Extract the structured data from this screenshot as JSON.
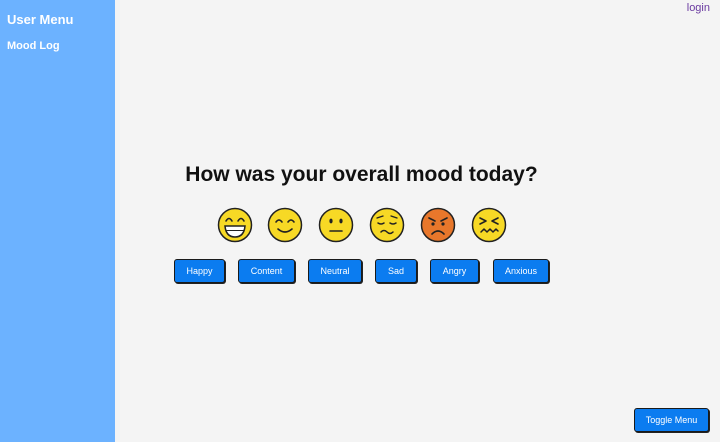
{
  "sidebar": {
    "title": "User Menu",
    "items": [
      {
        "label": "Mood Log"
      }
    ]
  },
  "header": {
    "login_label": "login"
  },
  "main": {
    "question": "How was your overall mood today?",
    "moods": [
      {
        "label": "Happy",
        "icon": "grinning-face-icon"
      },
      {
        "label": "Content",
        "icon": "smiling-face-icon"
      },
      {
        "label": "Neutral",
        "icon": "neutral-face-icon"
      },
      {
        "label": "Sad",
        "icon": "pensive-face-icon"
      },
      {
        "label": "Angry",
        "icon": "angry-face-icon"
      },
      {
        "label": "Anxious",
        "icon": "confounded-face-icon"
      }
    ]
  },
  "footer": {
    "toggle_label": "Toggle Menu"
  },
  "colors": {
    "sidebar": "#6cb2ff",
    "background": "#f4f4f4",
    "button": "#0b7cf0",
    "face_yellow": "#f7d925",
    "face_angry": "#e8772b",
    "link": "#6a3aa0"
  }
}
